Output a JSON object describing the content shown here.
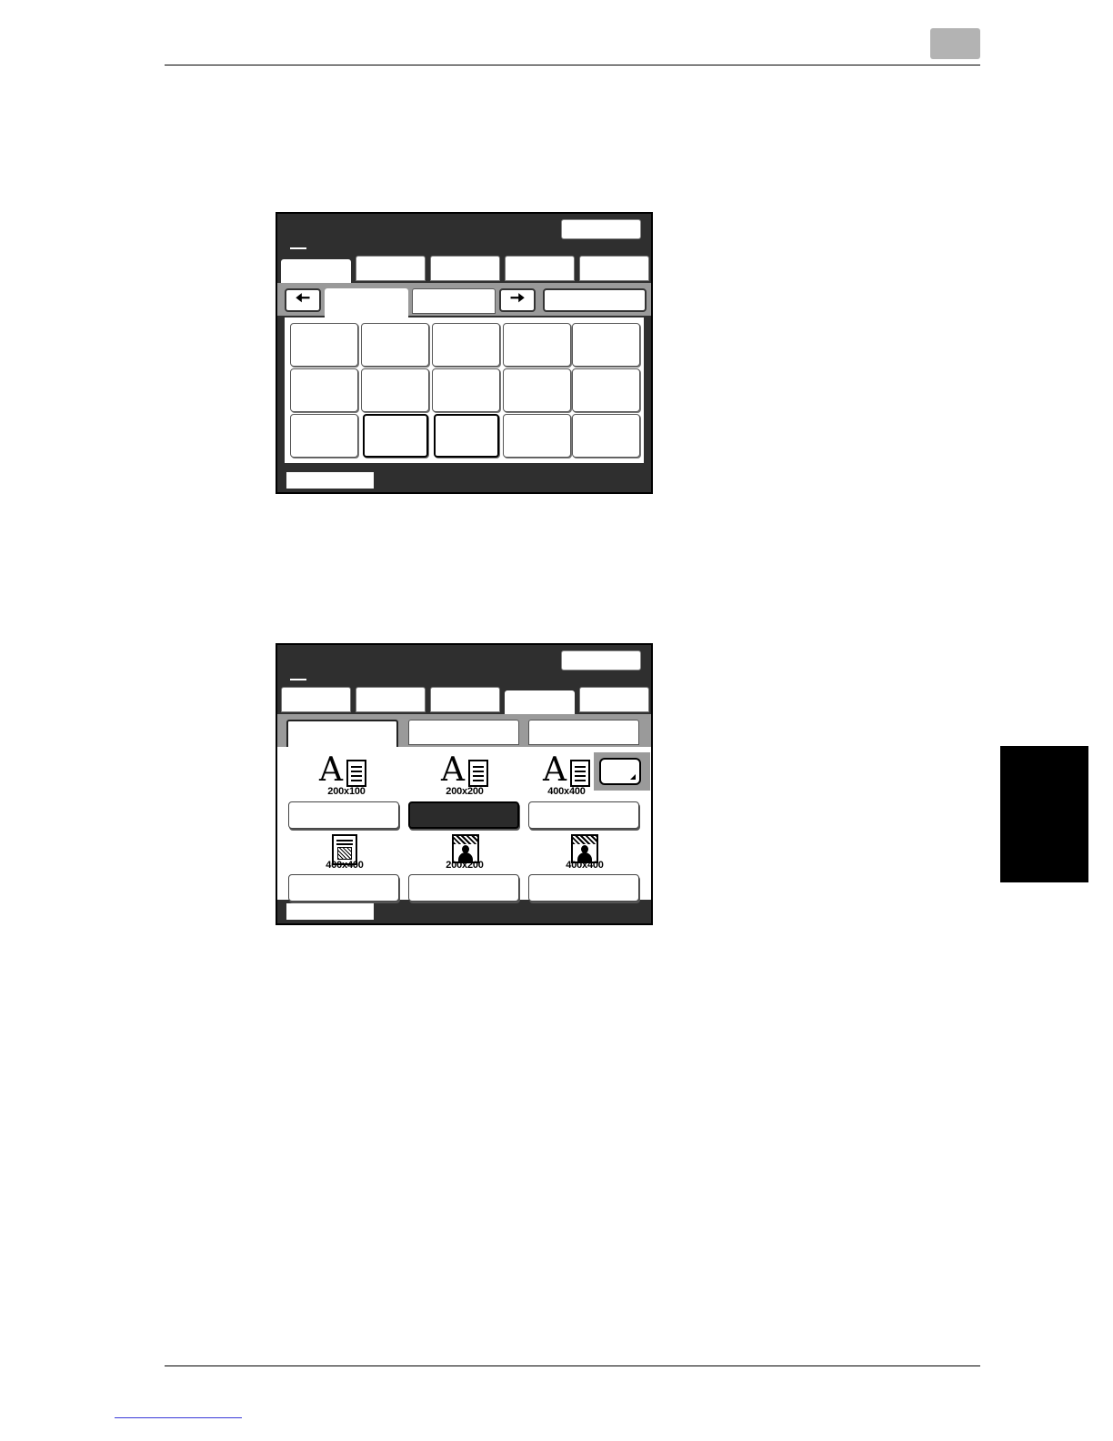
{
  "screens": [
    {
      "name": "destination-list-screen",
      "grid_selected": [
        11,
        12
      ]
    },
    {
      "name": "resolution-screen",
      "options": [
        {
          "label": "200x100",
          "icon": "text-document-icon",
          "selected": false
        },
        {
          "label": "200x200",
          "icon": "text-document-icon",
          "selected": true
        },
        {
          "label": "400x400",
          "icon": "text-document-icon",
          "selected": false
        },
        {
          "label": "400x400",
          "icon": "text-photo-document-icon",
          "selected": false
        },
        {
          "label": "200x200",
          "icon": "photo-document-icon",
          "selected": false
        },
        {
          "label": "400x400",
          "icon": "photo-document-icon",
          "selected": false
        }
      ]
    }
  ],
  "colors": {
    "panel_background": "#2f2f2f",
    "page_tab_gray": "#b3b3b3",
    "side_tab": "#000000",
    "link_underline": "#3a3ad8"
  }
}
